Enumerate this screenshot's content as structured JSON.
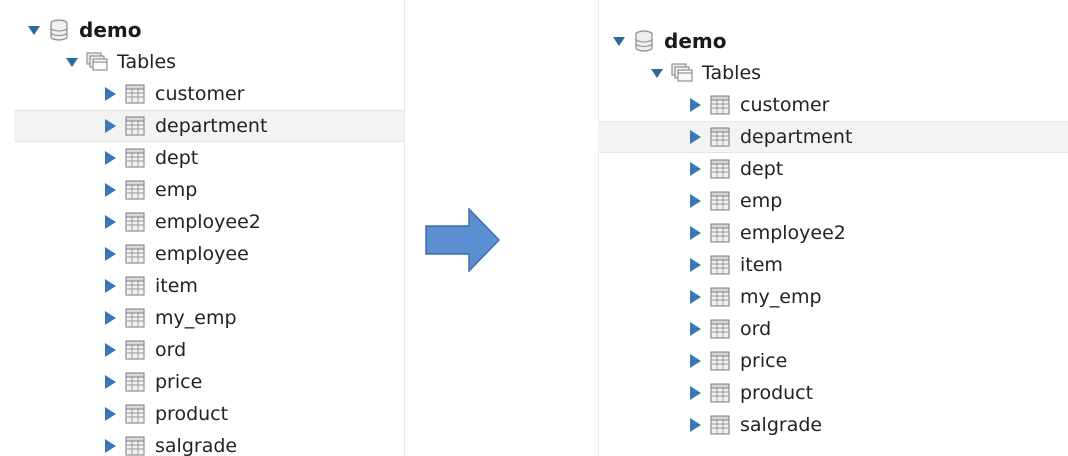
{
  "left": {
    "database": "demo",
    "folder": "Tables",
    "tables": [
      "customer",
      "department",
      "dept",
      "emp",
      "employee2",
      "employee",
      "item",
      "my_emp",
      "ord",
      "price",
      "product",
      "salgrade"
    ],
    "selected_index": 1
  },
  "right": {
    "database": "demo",
    "folder": "Tables",
    "tables": [
      "customer",
      "department",
      "dept",
      "emp",
      "employee2",
      "item",
      "my_emp",
      "ord",
      "price",
      "product",
      "salgrade"
    ],
    "selected_index": 1
  },
  "colors": {
    "arrow_fill": "#5b8fd0",
    "arrow_stroke": "#3f6fa8",
    "caret": "#3a78b6",
    "selected_row": "#f3f3f3"
  },
  "icons": {
    "database": "database-icon",
    "folder": "tables-folder-icon",
    "table": "table-grid-icon",
    "expanded": "chevron-down-icon",
    "collapsed": "chevron-right-icon",
    "transition": "right-arrow-icon"
  }
}
